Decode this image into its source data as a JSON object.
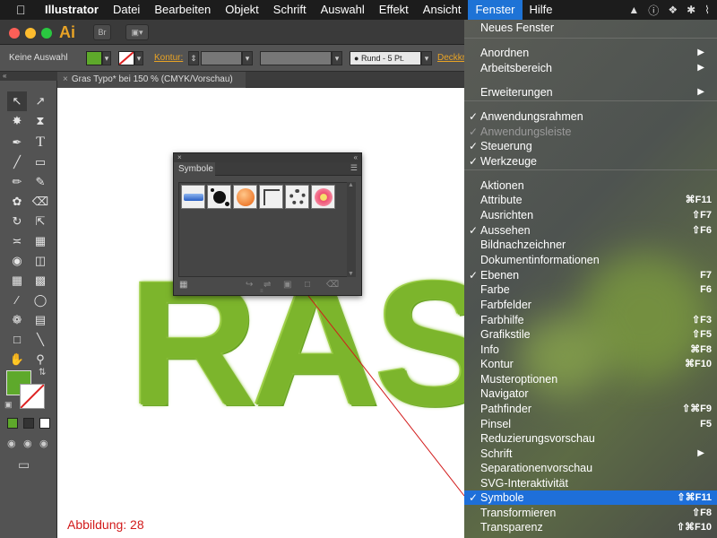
{
  "menubar": {
    "app": "Illustrator",
    "items": [
      "Datei",
      "Bearbeiten",
      "Objekt",
      "Schrift",
      "Auswahl",
      "Effekt",
      "Ansicht",
      "Fenster",
      "Hilfe"
    ],
    "active": "Fenster"
  },
  "titlebar": {
    "logo": "Ai",
    "bridge_label": "Br"
  },
  "control_bar": {
    "selection": "Keine Auswahl",
    "kontur_label": "Kontur:",
    "stroke_style": "Rund - 5 Pt.",
    "deckkraft_label": "Deckkr"
  },
  "document_tab": {
    "title": "Gras Typo* bei 150 % (CMYK/Vorschau)"
  },
  "artwork": {
    "text": "RAS"
  },
  "symbols_panel": {
    "title": "Symbole"
  },
  "figure_caption": "Abbildung: 28",
  "colors": {
    "menubar_bg": "#1c1c1c",
    "active_menu": "#1e73d6",
    "grass": "#7cb52c",
    "caption": "#d21b1b",
    "app_accent": "#e8a326"
  },
  "fenster_menu": {
    "items": [
      {
        "label": "Neues Fenster",
        "check": false,
        "shortcut": "",
        "arrow": false,
        "disabled": false,
        "selected": false
      },
      {
        "label": "Anordnen",
        "check": false,
        "shortcut": "",
        "arrow": true,
        "disabled": false,
        "selected": false
      },
      {
        "label": "Arbeitsbereich",
        "check": false,
        "shortcut": "",
        "arrow": true,
        "disabled": false,
        "selected": false
      },
      {
        "label": "Erweiterungen",
        "check": false,
        "shortcut": "",
        "arrow": true,
        "disabled": false,
        "selected": false
      },
      {
        "label": "Anwendungsrahmen",
        "check": true,
        "shortcut": "",
        "arrow": false,
        "disabled": false,
        "selected": false
      },
      {
        "label": "Anwendungsleiste",
        "check": true,
        "shortcut": "",
        "arrow": false,
        "disabled": true,
        "selected": false
      },
      {
        "label": "Steuerung",
        "check": true,
        "shortcut": "",
        "arrow": false,
        "disabled": false,
        "selected": false
      },
      {
        "label": "Werkzeuge",
        "check": true,
        "shortcut": "",
        "arrow": false,
        "disabled": false,
        "selected": false
      },
      {
        "label": "Aktionen",
        "check": false,
        "shortcut": "",
        "arrow": false,
        "disabled": false,
        "selected": false
      },
      {
        "label": "Attribute",
        "check": false,
        "shortcut": "⌘F11",
        "arrow": false,
        "disabled": false,
        "selected": false
      },
      {
        "label": "Ausrichten",
        "check": false,
        "shortcut": "⇧F7",
        "arrow": false,
        "disabled": false,
        "selected": false
      },
      {
        "label": "Aussehen",
        "check": true,
        "shortcut": "⇧F6",
        "arrow": false,
        "disabled": false,
        "selected": false
      },
      {
        "label": "Bildnachzeichner",
        "check": false,
        "shortcut": "",
        "arrow": false,
        "disabled": false,
        "selected": false
      },
      {
        "label": "Dokumentinformationen",
        "check": false,
        "shortcut": "",
        "arrow": false,
        "disabled": false,
        "selected": false
      },
      {
        "label": "Ebenen",
        "check": true,
        "shortcut": "F7",
        "arrow": false,
        "disabled": false,
        "selected": false
      },
      {
        "label": "Farbe",
        "check": false,
        "shortcut": "F6",
        "arrow": false,
        "disabled": false,
        "selected": false
      },
      {
        "label": "Farbfelder",
        "check": false,
        "shortcut": "",
        "arrow": false,
        "disabled": false,
        "selected": false
      },
      {
        "label": "Farbhilfe",
        "check": false,
        "shortcut": "⇧F3",
        "arrow": false,
        "disabled": false,
        "selected": false
      },
      {
        "label": "Grafikstile",
        "check": false,
        "shortcut": "⇧F5",
        "arrow": false,
        "disabled": false,
        "selected": false
      },
      {
        "label": "Info",
        "check": false,
        "shortcut": "⌘F8",
        "arrow": false,
        "disabled": false,
        "selected": false
      },
      {
        "label": "Kontur",
        "check": false,
        "shortcut": "⌘F10",
        "arrow": false,
        "disabled": false,
        "selected": false
      },
      {
        "label": "Musteroptionen",
        "check": false,
        "shortcut": "",
        "arrow": false,
        "disabled": false,
        "selected": false
      },
      {
        "label": "Navigator",
        "check": false,
        "shortcut": "",
        "arrow": false,
        "disabled": false,
        "selected": false
      },
      {
        "label": "Pathfinder",
        "check": false,
        "shortcut": "⇧⌘F9",
        "arrow": false,
        "disabled": false,
        "selected": false
      },
      {
        "label": "Pinsel",
        "check": false,
        "shortcut": "F5",
        "arrow": false,
        "disabled": false,
        "selected": false
      },
      {
        "label": "Reduzierungsvorschau",
        "check": false,
        "shortcut": "",
        "arrow": false,
        "disabled": false,
        "selected": false
      },
      {
        "label": "Schrift",
        "check": false,
        "shortcut": "",
        "arrow": true,
        "disabled": false,
        "selected": false
      },
      {
        "label": "Separationenvorschau",
        "check": false,
        "shortcut": "",
        "arrow": false,
        "disabled": false,
        "selected": false
      },
      {
        "label": "SVG-Interaktivität",
        "check": false,
        "shortcut": "",
        "arrow": false,
        "disabled": false,
        "selected": false
      },
      {
        "label": "Symbole",
        "check": true,
        "shortcut": "⇧⌘F11",
        "arrow": false,
        "disabled": false,
        "selected": true
      },
      {
        "label": "Transformieren",
        "check": false,
        "shortcut": "⇧F8",
        "arrow": false,
        "disabled": false,
        "selected": false
      },
      {
        "label": "Transparenz",
        "check": false,
        "shortcut": "⇧⌘F10",
        "arrow": false,
        "disabled": false,
        "selected": false
      }
    ]
  }
}
